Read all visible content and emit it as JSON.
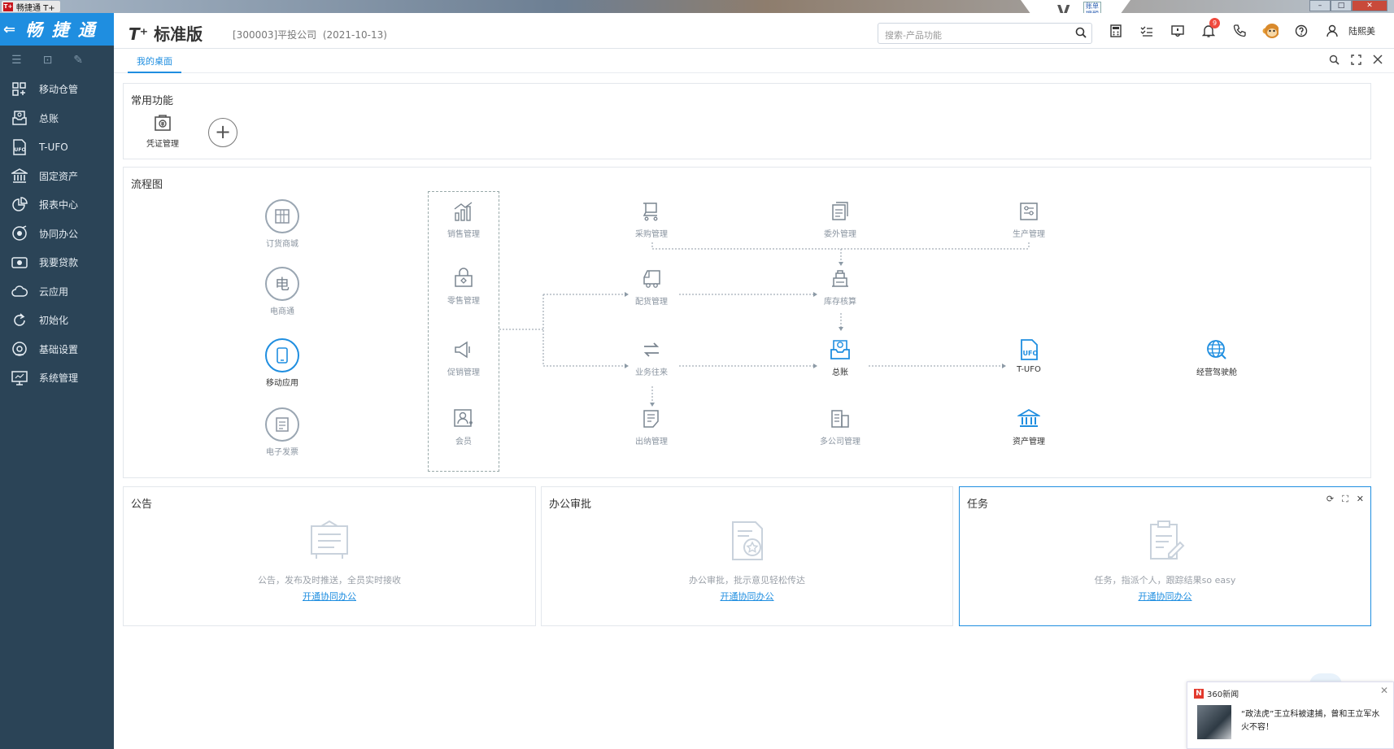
{
  "window": {
    "title": "畅捷通 T+",
    "logo_text": "T+"
  },
  "notch": {
    "v": "V",
    "label": "账单提醒"
  },
  "sidebar": {
    "logo": "畅 捷 通",
    "back_icon": "arrow-left-icon",
    "tools": [
      "menu-icon",
      "collapse-icon",
      "edit-icon"
    ],
    "items": [
      {
        "label": "移动仓管",
        "icon": "grid-app-icon"
      },
      {
        "label": "总账",
        "icon": "ledger-icon"
      },
      {
        "label": "T-UFO",
        "icon": "ufo-icon"
      },
      {
        "label": "固定资产",
        "icon": "bank-icon"
      },
      {
        "label": "报表中心",
        "icon": "pie-chart-icon"
      },
      {
        "label": "协同办公",
        "icon": "collab-icon"
      },
      {
        "label": "我要贷款",
        "icon": "loan-icon"
      },
      {
        "label": "云应用",
        "icon": "cloud-icon"
      },
      {
        "label": "初始化",
        "icon": "refresh-icon"
      },
      {
        "label": "基础设置",
        "icon": "settings-icon"
      },
      {
        "label": "系统管理",
        "icon": "monitor-icon"
      }
    ]
  },
  "topbar": {
    "brand_prefix": "T⁺",
    "brand": "标准版",
    "company": "[300003]平投公司",
    "date": "(2021-10-13)",
    "search_placeholder": "搜索-产品功能",
    "notification_count": "9",
    "user": "陆熙美"
  },
  "tabs": {
    "active": "我的桌面"
  },
  "common": {
    "title": "常用功能",
    "items": [
      {
        "label": "凭证管理",
        "icon": "voucher-icon"
      }
    ],
    "add": "+"
  },
  "flow": {
    "title": "流程图",
    "col1": [
      {
        "label": "订货商城",
        "icon": "store-icon"
      },
      {
        "label": "电商通",
        "icon": "ecommerce-icon"
      },
      {
        "label": "移动应用",
        "icon": "mobile-app-icon"
      },
      {
        "label": "电子发票",
        "icon": "e-invoice-icon"
      }
    ],
    "col2": [
      {
        "label": "销售管理",
        "icon": "sales-icon"
      },
      {
        "label": "零售管理",
        "icon": "retail-icon"
      },
      {
        "label": "促销管理",
        "icon": "promotion-icon"
      },
      {
        "label": "会员",
        "icon": "member-icon"
      }
    ],
    "purchase": {
      "label": "采购管理",
      "icon": "cart-icon"
    },
    "outsource": {
      "label": "委外管理",
      "icon": "outsource-icon"
    },
    "production": {
      "label": "生产管理",
      "icon": "production-icon"
    },
    "distribution": {
      "label": "配货管理",
      "icon": "truck-icon"
    },
    "inventory": {
      "label": "库存核算",
      "icon": "inventory-icon"
    },
    "business": {
      "label": "业务往来",
      "icon": "transfer-icon"
    },
    "ledger": {
      "label": "总账",
      "icon": "ledger-icon"
    },
    "tufo": {
      "label": "T-UFO",
      "icon": "ufo-icon"
    },
    "cockpit": {
      "label": "经营驾驶舱",
      "icon": "globe-icon"
    },
    "cashier": {
      "label": "出纳管理",
      "icon": "cashier-icon"
    },
    "multi": {
      "label": "多公司管理",
      "icon": "building-icon"
    },
    "assets": {
      "label": "资产管理",
      "icon": "bank-icon"
    }
  },
  "cards": [
    {
      "title": "公告",
      "text": "公告，发布及时推送，全员实时接收",
      "link": "开通协同办公",
      "icon": "notice-board-icon"
    },
    {
      "title": "办公审批",
      "text": "办公审批，批示意见轻松传达",
      "link": "开通协同办公",
      "icon": "approval-icon"
    },
    {
      "title": "任务",
      "text": "任务，指派个人，跟踪结果so easy",
      "link": "开通协同办公",
      "icon": "task-icon"
    }
  ],
  "news": {
    "source": "360新闻",
    "text": "“政法虎”王立科被逮捕，曾和王立军水火不容！"
  },
  "colors": {
    "sidebar": "#2b4457",
    "accent": "#1f8ee0",
    "logo_bg": "#1f8ee0"
  }
}
